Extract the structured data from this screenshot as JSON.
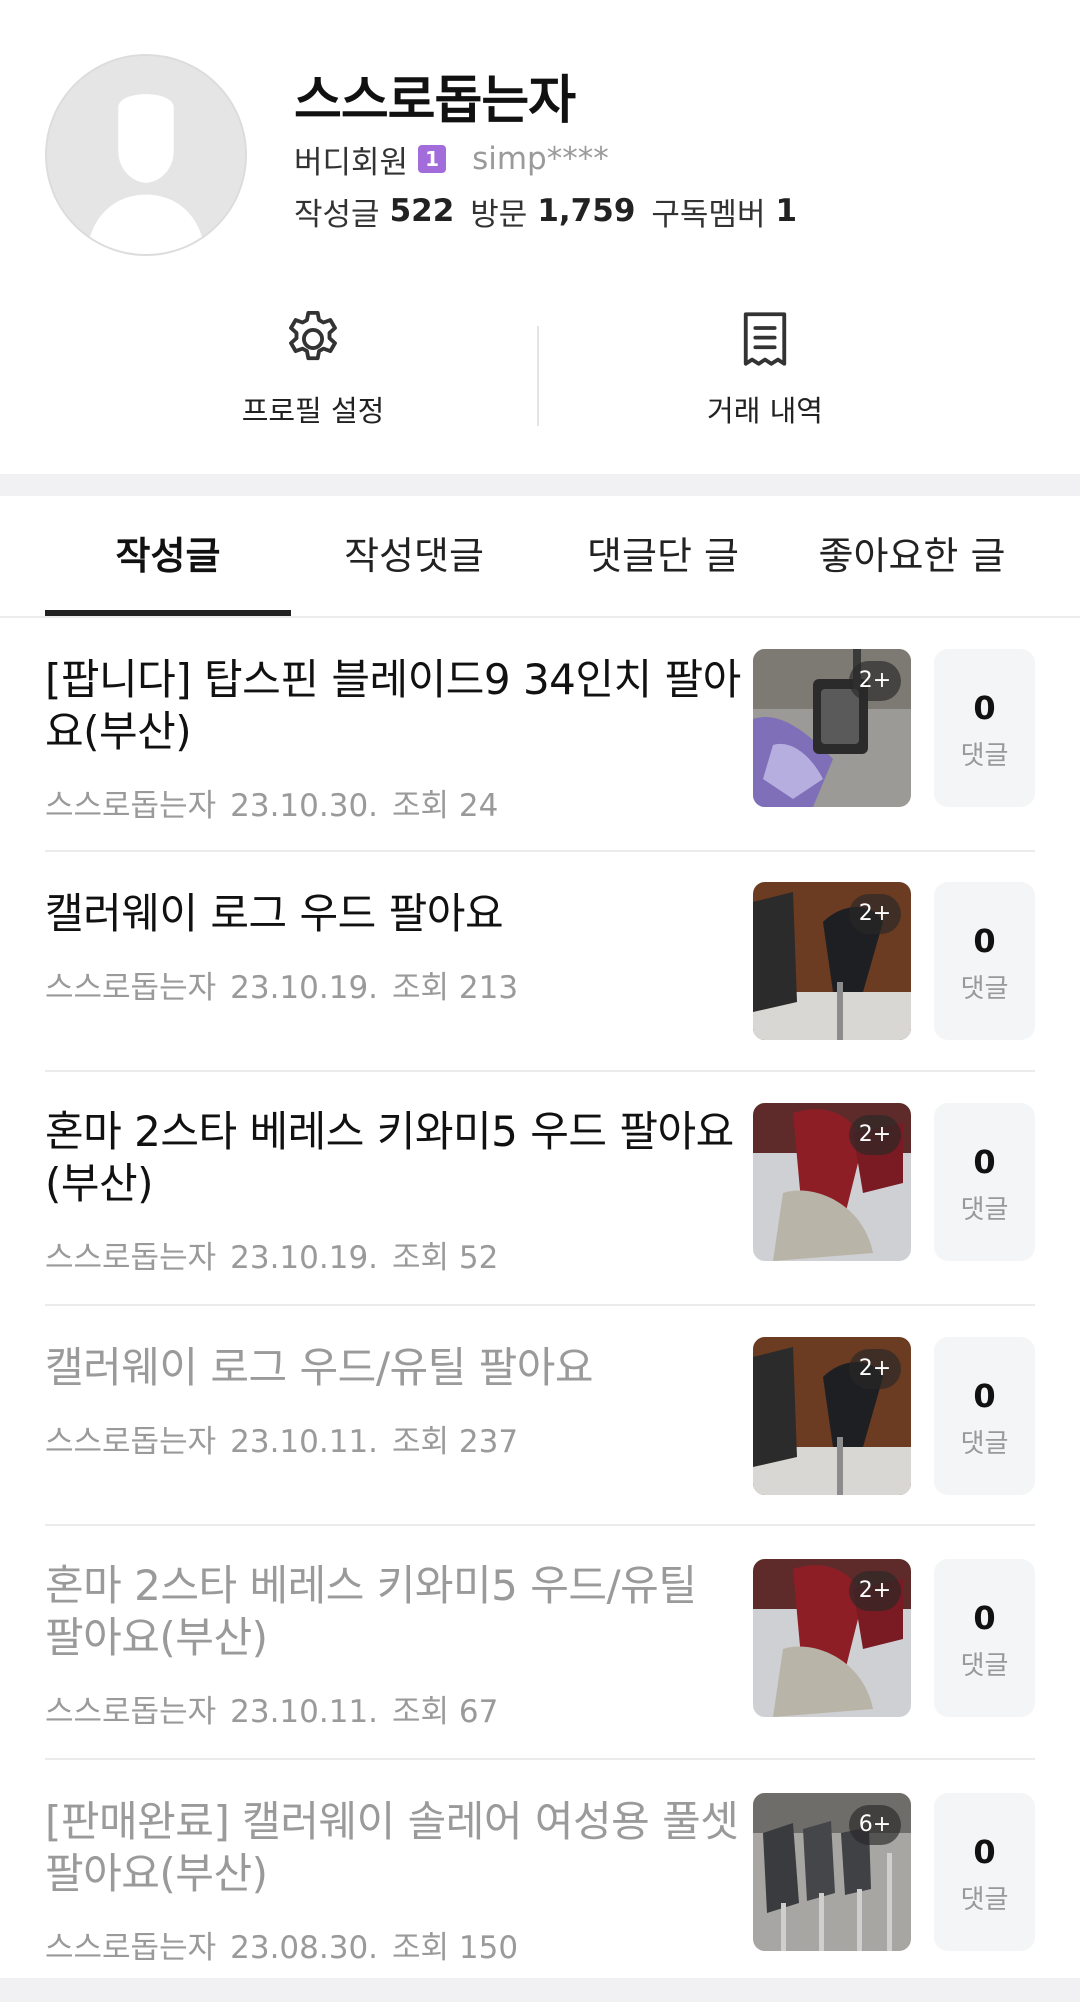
{
  "profile": {
    "nickname": "스스로돕는자",
    "grade": "버디회원",
    "grade_badge": "1",
    "user_id": "simp****",
    "stats": [
      {
        "label": "작성글",
        "value": "522"
      },
      {
        "label": "방문",
        "value": "1,759"
      },
      {
        "label": "구독멤버",
        "value": "1"
      }
    ]
  },
  "actions": {
    "settings_label": "프로필 설정",
    "settings_icon": "gear-icon",
    "trade_label": "거래 내역",
    "trade_icon": "receipt-icon"
  },
  "tabs": [
    {
      "label": "작성글",
      "active": true
    },
    {
      "label": "작성댓글",
      "active": false
    },
    {
      "label": "댓글단 글",
      "active": false
    },
    {
      "label": "좋아요한 글",
      "active": false
    }
  ],
  "posts": [
    {
      "title": "[팝니다] 탑스핀 블레이드9 34인치 팔아요(부산)",
      "author": "스스로돕는자",
      "date": "23.10.30.",
      "views": "조회 24",
      "image_count": "2+",
      "comments": "0",
      "comment_label": "댓글",
      "dimmed": false
    },
    {
      "title": "캘러웨이 로그 우드 팔아요",
      "author": "스스로돕는자",
      "date": "23.10.19.",
      "views": "조회 213",
      "image_count": "2+",
      "comments": "0",
      "comment_label": "댓글",
      "dimmed": false
    },
    {
      "title": "혼마 2스타 베레스 키와미5 우드 팔아요(부산)",
      "author": "스스로돕는자",
      "date": "23.10.19.",
      "views": "조회 52",
      "image_count": "2+",
      "comments": "0",
      "comment_label": "댓글",
      "dimmed": false
    },
    {
      "title": "캘러웨이 로그 우드/유틸 팔아요",
      "author": "스스로돕는자",
      "date": "23.10.11.",
      "views": "조회 237",
      "image_count": "2+",
      "comments": "0",
      "comment_label": "댓글",
      "dimmed": true
    },
    {
      "title": "혼마 2스타 베레스 키와미5 우드/유틸 팔아요(부산)",
      "author": "스스로돕는자",
      "date": "23.10.11.",
      "views": "조회 67",
      "image_count": "2+",
      "comments": "0",
      "comment_label": "댓글",
      "dimmed": true
    },
    {
      "title": "[판매완료] 캘러웨이 솔레어 여성용 풀셋 팔아요(부산)",
      "author": "스스로돕는자",
      "date": "23.08.30.",
      "views": "조회 150",
      "image_count": "6+",
      "comments": "0",
      "comment_label": "댓글",
      "dimmed": true
    }
  ],
  "colors": {
    "grade_badge": "#a36cdb",
    "dimmed_text": "#9a9a9a",
    "section_gap": "#f1f1f3"
  }
}
